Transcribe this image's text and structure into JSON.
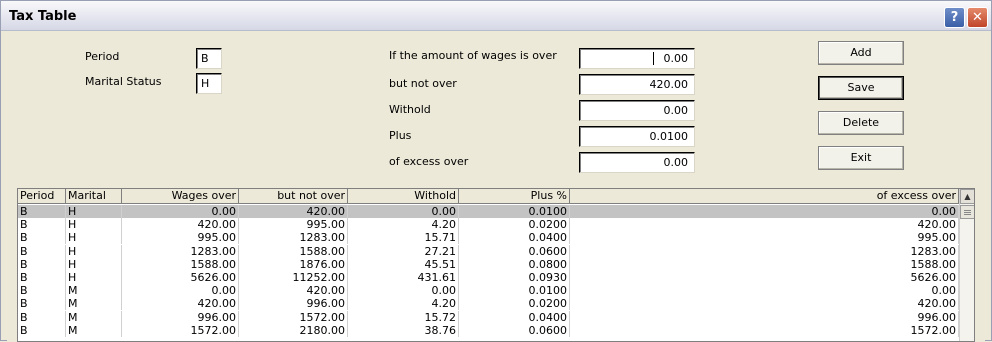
{
  "window": {
    "title": "Tax Table"
  },
  "form": {
    "period_label": "Period",
    "period_value": "B",
    "marital_label": "Marital Status",
    "marital_value": "H",
    "wages_over_label": "If the amount of wages is over",
    "wages_over_value": "0.00",
    "not_over_label": "but not over",
    "not_over_value": "420.00",
    "withold_label": "Withold",
    "withold_value": "0.00",
    "plus_label": "Plus",
    "plus_value": "0.0100",
    "excess_label": "of excess over",
    "excess_value": "0.00"
  },
  "buttons": {
    "add": "Add",
    "save": "Save",
    "delete": "Delete",
    "exit": "Exit"
  },
  "grid": {
    "columns": [
      "Period",
      "Marital",
      "Wages over",
      "but not over",
      "Withold",
      "Plus %",
      "of excess over"
    ],
    "selected_row": 0,
    "rows": [
      [
        "B",
        "H",
        "0.00",
        "420.00",
        "0.00",
        "0.0100",
        "0.00"
      ],
      [
        "B",
        "H",
        "420.00",
        "995.00",
        "4.20",
        "0.0200",
        "420.00"
      ],
      [
        "B",
        "H",
        "995.00",
        "1283.00",
        "15.71",
        "0.0400",
        "995.00"
      ],
      [
        "B",
        "H",
        "1283.00",
        "1588.00",
        "27.21",
        "0.0600",
        "1283.00"
      ],
      [
        "B",
        "H",
        "1588.00",
        "1876.00",
        "45.51",
        "0.0800",
        "1588.00"
      ],
      [
        "B",
        "H",
        "5626.00",
        "11252.00",
        "431.61",
        "0.0930",
        "5626.00"
      ],
      [
        "B",
        "M",
        "0.00",
        "420.00",
        "0.00",
        "0.0100",
        "0.00"
      ],
      [
        "B",
        "M",
        "420.00",
        "996.00",
        "4.20",
        "0.0200",
        "420.00"
      ],
      [
        "B",
        "M",
        "996.00",
        "1572.00",
        "15.72",
        "0.0400",
        "996.00"
      ],
      [
        "B",
        "M",
        "1572.00",
        "2180.00",
        "38.76",
        "0.0600",
        "1572.00"
      ]
    ]
  }
}
